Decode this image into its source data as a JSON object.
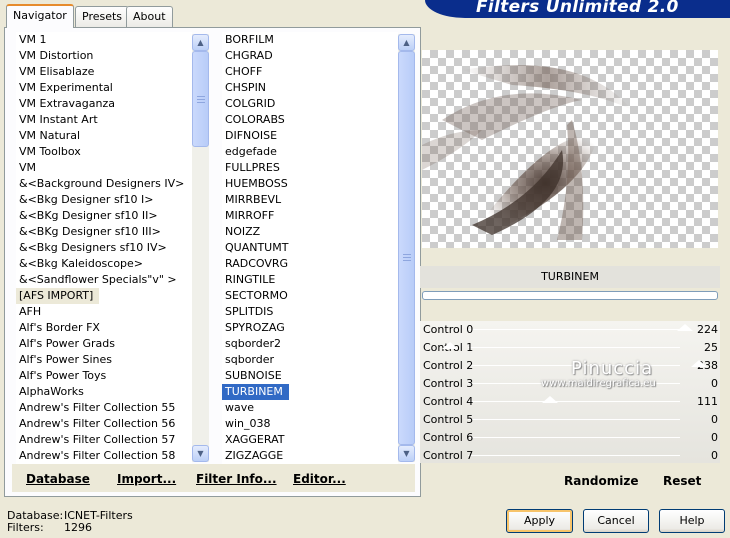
{
  "app": {
    "title": "Filters Unlimited 2.0"
  },
  "tabs": [
    "Navigator",
    "Presets",
    "About"
  ],
  "categories": [
    "VM 1",
    "VM Distortion",
    "VM Elisablaze",
    "VM Experimental",
    "VM Extravaganza",
    "VM Instant Art",
    "VM Natural",
    "VM Toolbox",
    "VM",
    "&<Background Designers IV>",
    "&<Bkg Designer sf10 I>",
    "&<BKg Designer sf10 II>",
    "&<BKg Designer sf10 III>",
    "&<Bkg Designers sf10 IV>",
    "&<Bkg Kaleidoscope>",
    "&<Sandflower Specials\"v\" >",
    "[AFS IMPORT]",
    "AFH",
    "Alf's Border FX",
    "Alf's Power Grads",
    "Alf's Power Sines",
    "Alf's Power Toys",
    "AlphaWorks",
    "Andrew's Filter Collection 55",
    "Andrew's Filter Collection 56",
    "Andrew's Filter Collection 57",
    "Andrew's Filter Collection 58"
  ],
  "categories_highlighted": "[AFS IMPORT]",
  "filters": [
    "BORFILM",
    "CHGRAD",
    "CHOFF",
    "CHSPIN",
    "COLGRID",
    "COLORABS",
    "DIFNOISE",
    "edgefade",
    "FULLPRES",
    "HUEMBOSS",
    "MIRRBEVL",
    "MIRROFF",
    "NOIZZ",
    "QUANTUMT",
    "RADCOVRG",
    "RINGTILE",
    "SECTORMO",
    "SPLITDIS",
    "SPYROZAG",
    "sqborder2",
    "sqborder",
    "SUBNOISE",
    "TURBINEM",
    "wave",
    "win_038",
    "XAGGERAT",
    "ZIGZAGGE"
  ],
  "selected_filter": "TURBINEM",
  "nav_buttons": {
    "database": "Database",
    "import": "Import...",
    "filter_info": "Filter Info...",
    "editor": "Editor..."
  },
  "preview_filter_name": "TURBINEM",
  "controls": [
    {
      "label": "Control 0",
      "value": "224"
    },
    {
      "label": "Control 1",
      "value": "25"
    },
    {
      "label": "Control 2",
      "value": "238"
    },
    {
      "label": "Control 3",
      "value": "0"
    },
    {
      "label": "Control 4",
      "value": "111"
    },
    {
      "label": "Control 5",
      "value": "0"
    },
    {
      "label": "Control 6",
      "value": "0"
    },
    {
      "label": "Control 7",
      "value": "0"
    }
  ],
  "watermark": {
    "name": "Pinuccia",
    "url": "www.maidiregrafica.eu"
  },
  "actions": {
    "randomize": "Randomize",
    "reset": "Reset"
  },
  "status": {
    "database_label": "Database:",
    "database_value": "ICNET-Filters",
    "filters_label": "Filters:",
    "filters_value": "1296"
  },
  "dialog_buttons": {
    "apply": "Apply",
    "cancel": "Cancel",
    "help": "Help"
  },
  "icons": {
    "scroll_up": "chevron-up-icon",
    "scroll_down": "chevron-down-icon"
  },
  "colors": {
    "accent": "#0a2d8c",
    "selection": "#316ac5",
    "tab_highlight": "#e68b2c"
  }
}
